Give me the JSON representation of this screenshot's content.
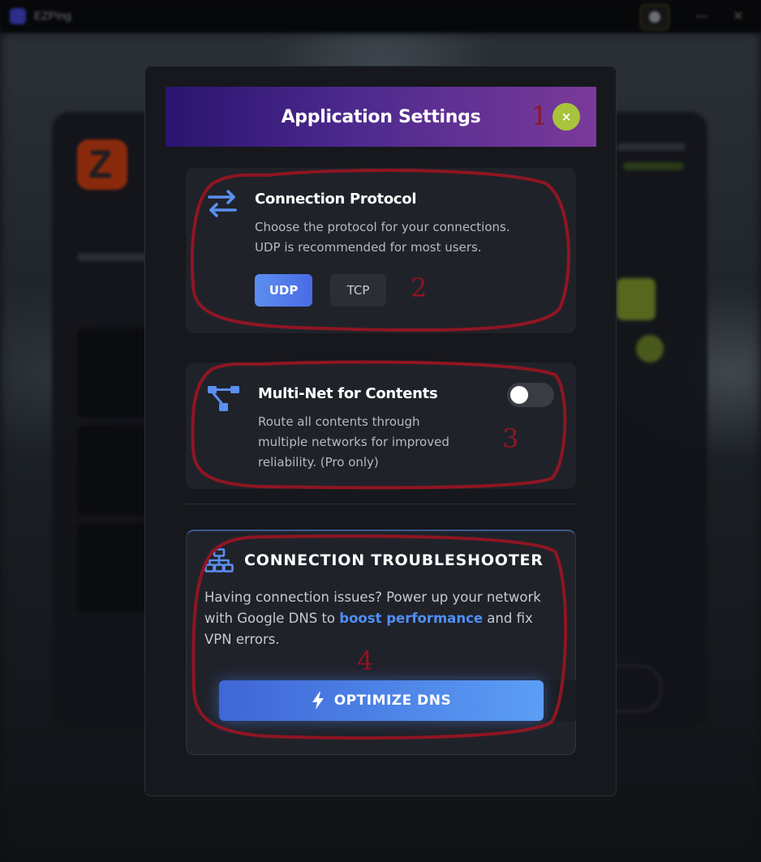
{
  "background_app": {
    "window_title": "EZPing",
    "titlebar_buttons": {
      "minimize": "—",
      "close": "✕"
    }
  },
  "modal": {
    "title": "Application Settings",
    "close_label": "×"
  },
  "connection_protocol": {
    "icon": "swap-arrows-icon",
    "title": "Connection Protocol",
    "description_line1": "Choose the protocol for your connections.",
    "description_line2": "UDP is recommended for most users.",
    "options": [
      "UDP",
      "TCP"
    ],
    "selected": "UDP"
  },
  "multi_net": {
    "icon": "network-branch-icon",
    "title": "Multi-Net for Contents",
    "description_line1": "Route all contents through",
    "description_line2": "multiple networks for improved",
    "description_line3": "reliability. (Pro only)",
    "enabled": false
  },
  "troubleshooter": {
    "icon": "network-topology-icon",
    "title": "CONNECTION TROUBLESHOOTER",
    "description_part1": "Having connection issues? Power up your network with Google DNS to ",
    "description_highlight": "boost performance",
    "description_part2": " and fix VPN errors.",
    "button_icon": "lightning-icon",
    "button_label": "OPTIMIZE DNS"
  },
  "annotations": [
    "1",
    "2",
    "3",
    "4"
  ],
  "colors": {
    "accent_blue": "#4f8ff5",
    "close_green": "#a8c43c",
    "header_purple": "#4e2a8e",
    "annotation_red": "#8e1622"
  }
}
